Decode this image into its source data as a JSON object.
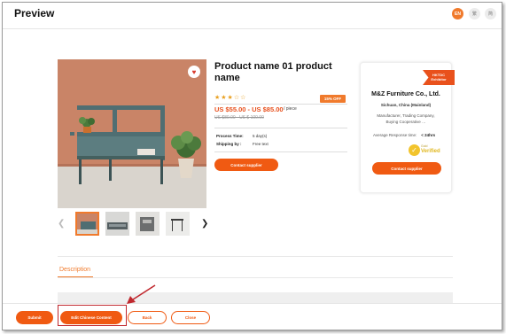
{
  "header": {
    "title": "Preview",
    "lang_en": "EN",
    "lang_2": "繁",
    "lang_3": "简"
  },
  "product": {
    "name": "Product name 01 product name",
    "rating_stars": "★★★☆☆",
    "rating": 3.5,
    "discount_badge": "15% OFF",
    "price_range": "US $55.00 - US $85.00",
    "price_unit": "/ piece",
    "original_price": "US $80.00 - US $ 100.00",
    "specs": [
      {
        "label": "Process Time:",
        "value": "5 day(s)"
      },
      {
        "label": "Shipping by :",
        "value": "Free text"
      }
    ],
    "contact_label": "Contact supplier",
    "wishlist_icon": "heart-icon"
  },
  "supplier": {
    "ribbon_line1": "HKTDC",
    "ribbon_line2": "Exhibitor",
    "name": "M&Z Furniture Co., Ltd.",
    "location": "Sichuan, China (Mainland)",
    "business_type_line1": "Manufacturer, Trading Company,",
    "business_type_line2": "Buying Cooperative …",
    "response_label": "Average Response time:",
    "response_value": "< 24hrs",
    "verified_small": "Gold",
    "verified_label": "Verified",
    "contact_label": "Contact supplier"
  },
  "tabs": {
    "description": "Description"
  },
  "footer": {
    "submit": "Submit",
    "edit_chinese": "Edit Chinese Content",
    "back": "Back",
    "close": "Close"
  },
  "colors": {
    "accent": "#f05a12",
    "annotation": "#c0282e"
  }
}
